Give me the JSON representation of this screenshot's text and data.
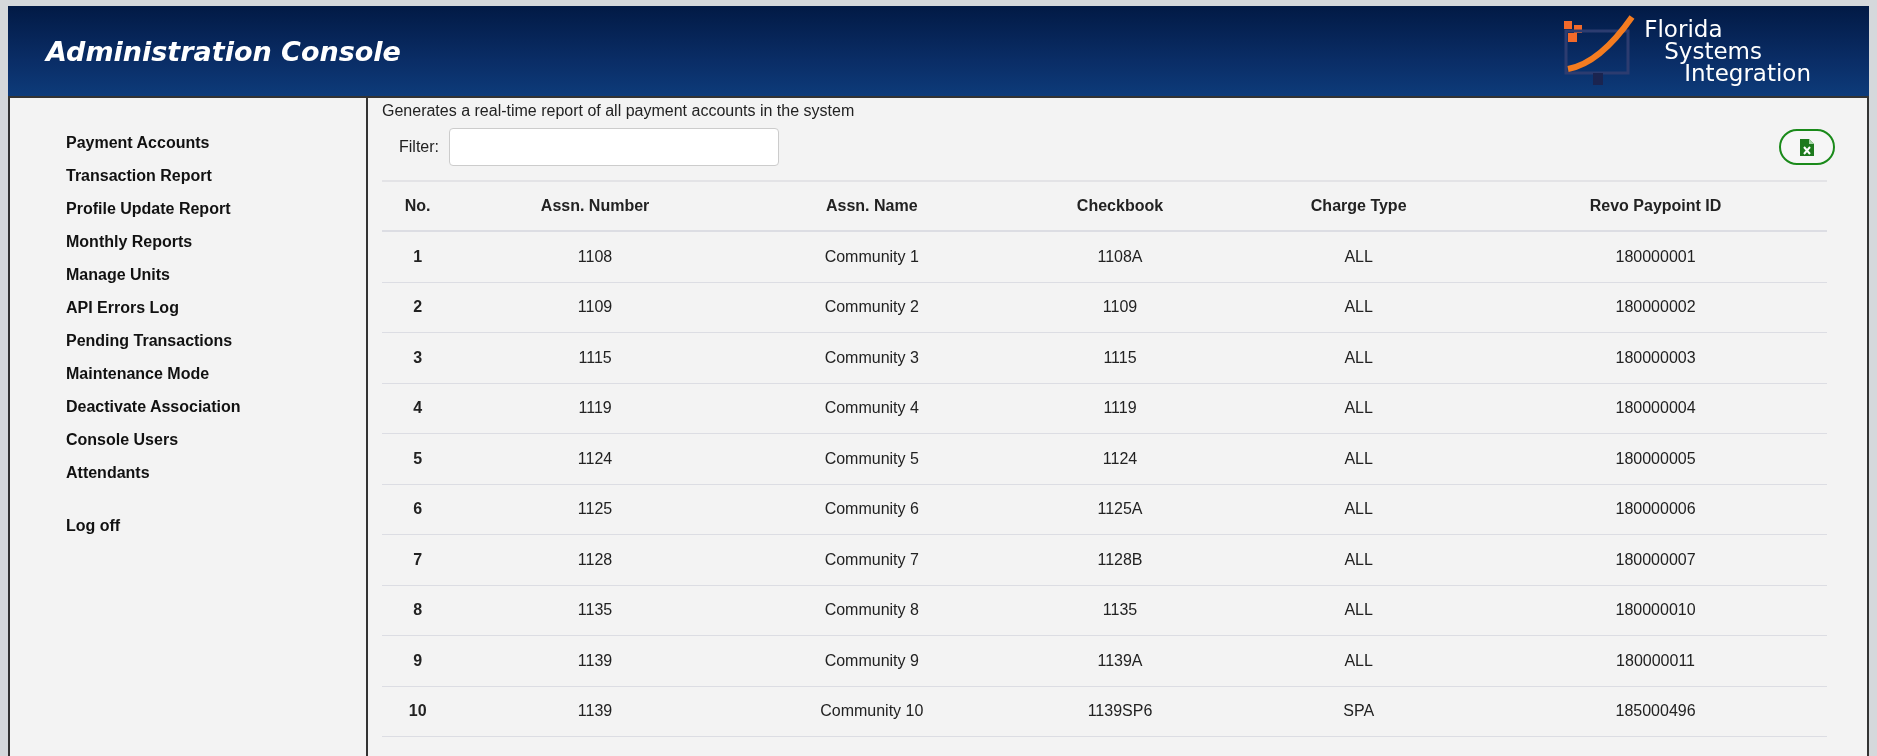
{
  "header": {
    "title": "Administration Console",
    "logo_lines": [
      "Florida",
      "Systems",
      "Integration"
    ]
  },
  "sidebar": {
    "items": [
      {
        "label": "Payment Accounts"
      },
      {
        "label": "Transaction Report"
      },
      {
        "label": "Profile Update Report"
      },
      {
        "label": "Monthly Reports"
      },
      {
        "label": "Manage Units"
      },
      {
        "label": "API Errors Log"
      },
      {
        "label": "Pending Transactions"
      },
      {
        "label": "Maintenance Mode"
      },
      {
        "label": "Deactivate Association"
      },
      {
        "label": "Console Users"
      },
      {
        "label": "Attendants"
      }
    ],
    "logoff": "Log off"
  },
  "main": {
    "description": "Generates a real-time report of all payment accounts in the system",
    "filter": {
      "label": "Filter:"
    }
  },
  "table": {
    "columns": [
      "No.",
      "Assn. Number",
      "Assn. Name",
      "Checkbook",
      "Charge Type",
      "Revo Paypoint ID"
    ],
    "rows": [
      [
        "1",
        "1108",
        "Community 1",
        "1108A",
        "ALL",
        "180000001"
      ],
      [
        "2",
        "1109",
        "Community 2",
        "1109",
        "ALL",
        "180000002"
      ],
      [
        "3",
        "1115",
        "Community 3",
        "1115",
        "ALL",
        "180000003"
      ],
      [
        "4",
        "1119",
        "Community 4",
        "1119",
        "ALL",
        "180000004"
      ],
      [
        "5",
        "1124",
        "Community 5",
        "1124",
        "ALL",
        "180000005"
      ],
      [
        "6",
        "1125",
        "Community 6",
        "1125A",
        "ALL",
        "180000006"
      ],
      [
        "7",
        "1128",
        "Community 7",
        "1128B",
        "ALL",
        "180000007"
      ],
      [
        "8",
        "1135",
        "Community 8",
        "1135",
        "ALL",
        "180000010"
      ],
      [
        "9",
        "1139",
        "Community 9",
        "1139A",
        "ALL",
        "180000011"
      ],
      [
        "10",
        "1139",
        "Community 10",
        "1139SP6",
        "SPA",
        "185000496"
      ]
    ]
  }
}
